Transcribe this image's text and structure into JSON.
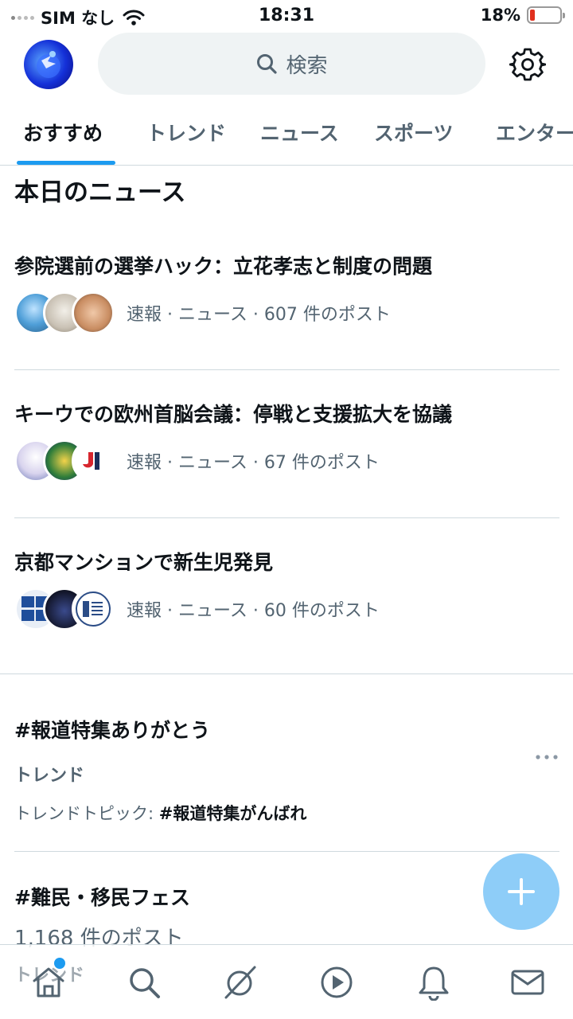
{
  "status_bar": {
    "carrier": "SIM なし",
    "time": "18:31",
    "battery_percent": "18%",
    "battery_level": 0.18,
    "icons": [
      "signal-icon",
      "wifi-icon",
      "battery-icon"
    ]
  },
  "header": {
    "avatar_icon": "profile-avatar",
    "search_placeholder": "検索",
    "settings_icon": "gear-icon"
  },
  "tabs": [
    {
      "label": "おすすめ",
      "active": true
    },
    {
      "label": "トレンド",
      "active": false
    },
    {
      "label": "ニュース",
      "active": false
    },
    {
      "label": "スポーツ",
      "active": false
    },
    {
      "label": "エンター",
      "active": false
    }
  ],
  "news_section": {
    "title": "本日のニュース",
    "items": [
      {
        "title": "参院選前の選挙ハック：立花孝志と制度の問題",
        "meta": "速報 · ニュース · 607 件のポスト"
      },
      {
        "title": "キーウでの欧州首脳会議：停戦と支援拡大を協議",
        "meta": "速報 · ニュース · 67 件のポスト"
      },
      {
        "title": "京都マンションで新生児発見",
        "meta": "速報 · ニュース · 60 件のポスト"
      }
    ]
  },
  "trends": [
    {
      "title": "#報道特集ありがとう",
      "category": "トレンド",
      "topic_label": "トレンドトピック: ",
      "topic_value": "#報道特集がんばれ"
    },
    {
      "title": "#難民・移民フェス",
      "count": "1,168 件のポスト",
      "category": "トレンド"
    }
  ],
  "fab": {
    "icon": "plus-icon"
  },
  "bottom_nav": {
    "items": [
      "home-icon",
      "search-icon",
      "grok-icon",
      "play-icon",
      "bell-icon",
      "mail-icon"
    ],
    "has_notification_dot": true
  },
  "colors": {
    "accent": "#1d9bf0",
    "text_primary": "#0f1419",
    "text_secondary": "#536471",
    "fab": "#8ecdf8",
    "battery_low": "#e0301e"
  }
}
